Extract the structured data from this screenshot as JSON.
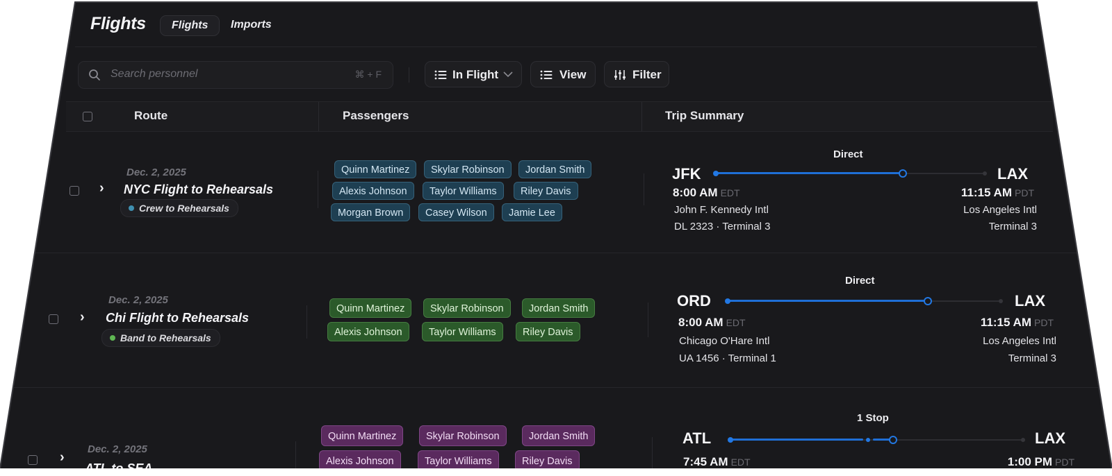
{
  "app": {
    "title": "Flights",
    "tabs": [
      {
        "label": "Flights",
        "active": true
      },
      {
        "label": "Imports",
        "active": false
      }
    ]
  },
  "toolbar": {
    "search_placeholder": "Search personnel",
    "search_shortcut": "⌘ + F",
    "status_label": "In Flight",
    "view_label": "View",
    "filter_label": "Filter"
  },
  "table": {
    "columns": [
      "Route",
      "Passengers",
      "Trip Summary"
    ]
  },
  "rows": [
    {
      "date": "Dec. 2, 2025",
      "title": "NYC Flight to Rehearsals",
      "tag": "Crew to Rehearsals",
      "tag_color": "#3f8fb0",
      "chip_color": "blue",
      "passengers": [
        "Quinn Martinez",
        "Skylar Robinson",
        "Jordan Smith",
        "Alexis Johnson",
        "Taylor Williams",
        "Riley Davis",
        "Morgan Brown",
        "Casey Wilson",
        "Jamie Lee"
      ],
      "trip": {
        "stops": "Direct",
        "origin": {
          "code": "JFK",
          "time": "8:00 AM",
          "tz": "EDT",
          "airport": "John F. Kennedy Intl",
          "detail": "DL 2323 · Terminal 3"
        },
        "dest": {
          "code": "LAX",
          "time": "11:15 AM",
          "tz": "PDT",
          "airport": "Los Angeles Intl",
          "detail": "Terminal 3"
        }
      }
    },
    {
      "date": "Dec. 2, 2025",
      "title": "Chi Flight to Rehearsals",
      "tag": "Band to Rehearsals",
      "tag_color": "#5fb653",
      "chip_color": "green",
      "passengers": [
        "Quinn Martinez",
        "Skylar Robinson",
        "Jordan Smith",
        "Alexis Johnson",
        "Taylor Williams",
        "Riley Davis"
      ],
      "trip": {
        "stops": "Direct",
        "origin": {
          "code": "ORD",
          "time": "8:00 AM",
          "tz": "EDT",
          "airport": "Chicago O'Hare Intl",
          "detail": "UA 1456 · Terminal 1"
        },
        "dest": {
          "code": "LAX",
          "time": "11:15 AM",
          "tz": "PDT",
          "airport": "Los Angeles Intl",
          "detail": "Terminal 3"
        }
      }
    },
    {
      "date": "Dec. 2, 2025",
      "title": "ATL to SEA",
      "chip_color": "purple",
      "passengers": [
        "Quinn Martinez",
        "Skylar Robinson",
        "Jordan Smith",
        "Alexis Johnson",
        "Taylor Williams",
        "Riley Davis"
      ],
      "trip": {
        "stops": "1 Stop",
        "origin": {
          "code": "ATL",
          "time": "7:45 AM",
          "tz": "EDT"
        },
        "dest": {
          "code": "LAX",
          "time": "1:00 PM",
          "tz": "PDT"
        }
      }
    }
  ]
}
